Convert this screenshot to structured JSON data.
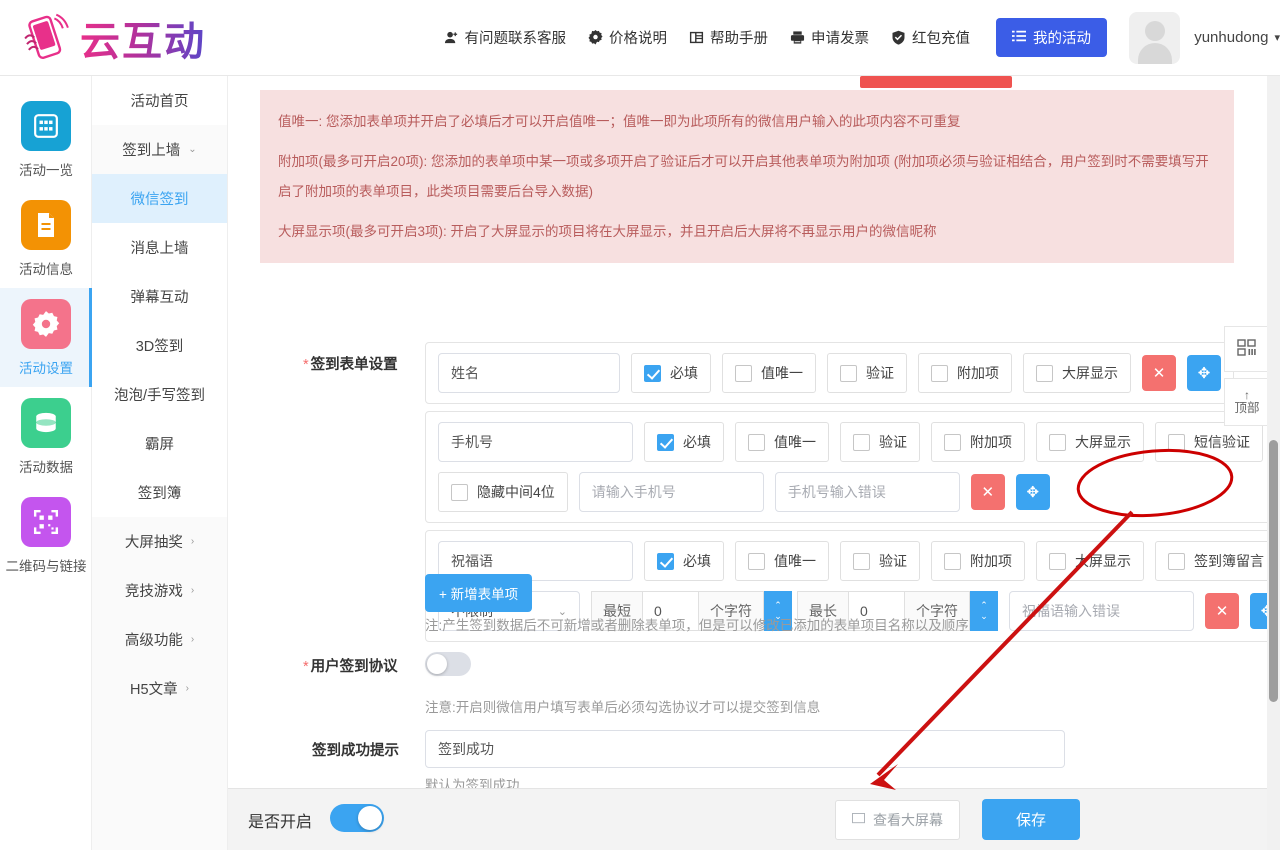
{
  "header": {
    "logo_text": "云互动",
    "logo_icon": "phone-hand-icon",
    "nav": [
      {
        "label": "有问题联系客服",
        "icon": "user-add-icon"
      },
      {
        "label": "价格说明",
        "icon": "gear-icon"
      },
      {
        "label": "帮助手册",
        "icon": "book-icon"
      },
      {
        "label": "申请发票",
        "icon": "printer-icon"
      },
      {
        "label": "红包充值",
        "icon": "shield-check-icon"
      }
    ],
    "my_activity": {
      "label": "我的活动",
      "icon": "list-icon"
    },
    "avatar_icon": "avatar-placeholder-icon",
    "user_name": "yunhudong",
    "user_caret": "▾"
  },
  "rail": {
    "items": [
      {
        "label": "活动一览",
        "icon": "grid-icon",
        "color": "#17a2d4",
        "glyph": "▦",
        "active": false
      },
      {
        "label": "活动信息",
        "icon": "document-icon",
        "color": "#f39204",
        "glyph": "🗎",
        "active": false
      },
      {
        "label": "活动设置",
        "icon": "gear-icon",
        "color": "#f4738b",
        "glyph": "✿",
        "active": true
      },
      {
        "label": "活动数据",
        "icon": "database-icon",
        "color": "#3ccf8e",
        "glyph": "▤",
        "active": false
      },
      {
        "label": "二维码与链接",
        "icon": "qrcode-icon",
        "color": "#c455ee",
        "glyph": "▩",
        "active": false
      }
    ]
  },
  "menu": {
    "items": [
      {
        "label": "活动首页",
        "type": "item",
        "active": false
      },
      {
        "label": "签到上墙",
        "type": "group",
        "caret": "⌄",
        "active": false
      },
      {
        "label": "微信签到",
        "type": "item",
        "active": true
      },
      {
        "label": "消息上墙",
        "type": "item",
        "active": false
      },
      {
        "label": "弹幕互动",
        "type": "item",
        "active": false
      },
      {
        "label": "3D签到",
        "type": "item",
        "active": false
      },
      {
        "label": "泡泡/手写签到",
        "type": "item",
        "active": false
      },
      {
        "label": "霸屏",
        "type": "item",
        "active": false
      },
      {
        "label": "签到簿",
        "type": "item",
        "active": false
      },
      {
        "label": "大屏抽奖",
        "type": "group",
        "caret": "›",
        "active": false
      },
      {
        "label": "竞技游戏",
        "type": "group",
        "caret": "›",
        "active": false
      },
      {
        "label": "高级功能",
        "type": "group",
        "caret": "›",
        "active": false
      },
      {
        "label": "H5文章",
        "type": "group",
        "caret": "›",
        "active": false
      }
    ]
  },
  "notice": {
    "lines": [
      "值唯一: 您添加表单项并开启了必填后才可以开启值唯一；值唯一即为此项所有的微信用户输入的此项内容不可重复",
      "附加项(最多可开启20项): 您添加的表单项中某一项或多项开启了验证后才可以开启其他表单项为附加项 (附加项必须与验证相结合，用户签到时不需要填写开启了附加项的表单项目，此类项目需要后台导入数据)",
      "大屏显示项(最多可开启3项): 开启了大屏显示的项目将在大屏显示，并且开启后大屏将不再显示用户的微信昵称"
    ]
  },
  "form": {
    "section_label": "签到表单设置",
    "section_required": "*",
    "rows": [
      {
        "name_value": "姓名",
        "checkboxes": [
          {
            "label": "必填",
            "checked": true
          },
          {
            "label": "值唯一",
            "checked": false
          },
          {
            "label": "验证",
            "checked": false
          },
          {
            "label": "附加项",
            "checked": false
          },
          {
            "label": "大屏显示",
            "checked": false
          }
        ],
        "delete_icon": "close-icon",
        "move_icon": "move-icon"
      },
      {
        "name_value": "手机号",
        "checkboxes": [
          {
            "label": "必填",
            "checked": true
          },
          {
            "label": "值唯一",
            "checked": false
          },
          {
            "label": "验证",
            "checked": false
          },
          {
            "label": "附加项",
            "checked": false
          },
          {
            "label": "大屏显示",
            "checked": false
          },
          {
            "label": "短信验证",
            "checked": false
          }
        ],
        "hide_middle": {
          "label": "隐藏中间4位",
          "checked": false
        },
        "placeholder_value": "请输入手机号",
        "error_value": "手机号输入错误",
        "delete_icon": "close-icon",
        "move_icon": "move-icon"
      },
      {
        "name_value": "祝福语",
        "checkboxes": [
          {
            "label": "必填",
            "checked": true
          },
          {
            "label": "值唯一",
            "checked": false
          },
          {
            "label": "验证",
            "checked": false
          },
          {
            "label": "附加项",
            "checked": false
          },
          {
            "label": "大屏显示",
            "checked": false
          },
          {
            "label": "签到簿留言",
            "checked": false
          }
        ],
        "limit_select": "不限制",
        "min_label": "最短",
        "min_value": "0",
        "min_unit": "个字符",
        "max_label": "最长",
        "max_value": "0",
        "max_unit": "个字符",
        "error_value": "祝福语输入错误",
        "delete_icon": "close-icon",
        "move_icon": "move-icon"
      }
    ],
    "add_button": "+ 新增表单项",
    "add_note": "注:产生签到数据后不可新增或者删除表单项，但是可以修改已添加的表单项目名称以及顺序",
    "agreement_label": "用户签到协议",
    "agreement_required": "*",
    "agreement_on": false,
    "agreement_note": "注意:开启则微信用户填写表单后必须勾选协议才可以提交签到信息",
    "success_label": "签到成功提示",
    "success_value": "签到成功",
    "success_note": "默认为签到成功"
  },
  "float_widgets": [
    {
      "icon": "layout-grid-icon",
      "label": ""
    },
    {
      "icon": "arrow-up-icon",
      "label": "顶部",
      "arrow": "↑"
    }
  ],
  "bottom_bar": {
    "enable_label": "是否开启",
    "enable_on": true,
    "view_screen": {
      "label": "查看大屏幕",
      "icon": "screen-icon"
    },
    "save_label": "保存"
  },
  "annotations": {
    "ellipse_color": "#cc0000",
    "arrow_color": "#cc1111"
  },
  "colors": {
    "primary_blue": "#3ba4f1",
    "nav_blue": "#3b5de7",
    "danger_red": "#f4716f",
    "notice_bg": "#f7e0e0",
    "notice_text": "#b85c5c"
  }
}
